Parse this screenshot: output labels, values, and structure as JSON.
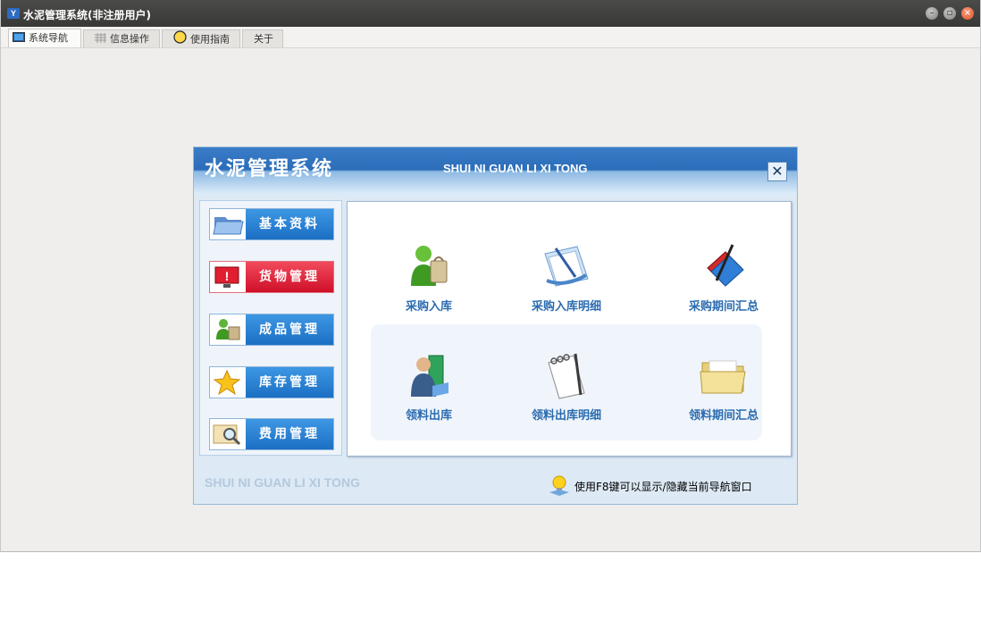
{
  "window": {
    "title": "水泥管理系统(非注册用户)",
    "logo_text": "Y"
  },
  "tabs": [
    {
      "label": "系统导航",
      "icon": "monitor-icon",
      "active": true
    },
    {
      "label": "信息操作",
      "icon": "grid-icon",
      "active": false
    },
    {
      "label": "使用指南",
      "icon": "help-icon",
      "active": false
    },
    {
      "label": "关于",
      "icon": "",
      "active": false
    }
  ],
  "panel": {
    "title": "水泥管理系统",
    "subtitle": "SHUI NI GUAN LI XI TONG",
    "close_glyph": "✕",
    "footer_brand": "SHUI NI GUAN LI XI TONG",
    "tip": "使用F8键可以显示/隐藏当前导航窗口"
  },
  "side_menu": [
    {
      "label": "基本资料",
      "icon": "folder-icon",
      "style": "blue"
    },
    {
      "label": "货物管理",
      "icon": "alert-monitor-icon",
      "style": "red"
    },
    {
      "label": "成品管理",
      "icon": "user-bag-icon",
      "style": "blue"
    },
    {
      "label": "库存管理",
      "icon": "star-icon",
      "style": "blue"
    },
    {
      "label": "费用管理",
      "icon": "magnifier-icon",
      "style": "blue"
    }
  ],
  "grid_items": [
    {
      "label": "采购入库",
      "icon": "user-bag-icon"
    },
    {
      "label": "采购入库明细",
      "icon": "document-pen-icon"
    },
    {
      "label": "采购期间汇总",
      "icon": "book-pen-icon"
    },
    {
      "label": "领料出库",
      "icon": "person-book-icon"
    },
    {
      "label": "领料出库明细",
      "icon": "notepad-pen-icon"
    },
    {
      "label": "领料期间汇总",
      "icon": "open-folder-icon"
    }
  ],
  "colors": {
    "accent_blue": "#1c6fc4",
    "accent_red": "#cf1028",
    "label_blue": "#2a6bb0"
  }
}
